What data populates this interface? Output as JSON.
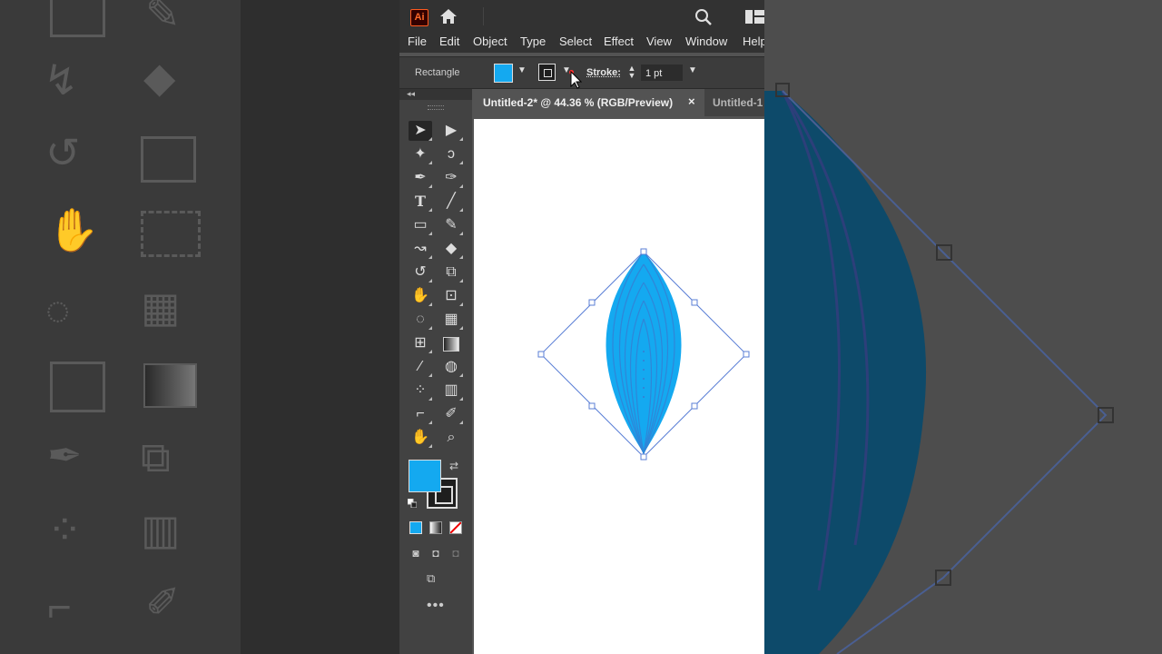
{
  "app": {
    "logo_text": "Ai"
  },
  "menu": [
    "File",
    "Edit",
    "Object",
    "Type",
    "Select",
    "Effect",
    "View",
    "Window",
    "Help"
  ],
  "control_bar": {
    "selection_label": "Rectangle",
    "fill_color": "#14a9f0",
    "stroke_label": "Stroke:",
    "stroke_weight": "1 pt"
  },
  "tabs": {
    "active": "Untitled-2* @ 44.36 % (RGB/Preview)",
    "close_symbol": "×",
    "inactive": "Untitled-1"
  },
  "toolbar": {
    "collapse": "◂◂",
    "tools": [
      "selection-tool",
      "direct-selection-tool",
      "magic-wand-tool",
      "lasso-tool",
      "pen-tool",
      "curvature-tool",
      "type-tool",
      "line-segment-tool",
      "rectangle-tool",
      "paintbrush-tool",
      "shaper-tool",
      "eraser-tool",
      "rotate-tool",
      "scale-tool",
      "puppet-warp-tool",
      "free-transform-tool",
      "shape-builder-tool",
      "perspective-grid-tool",
      "mesh-tool",
      "gradient-tool",
      "eyedropper-tool",
      "blend-tool",
      "symbol-sprayer-tool",
      "column-graph-tool",
      "artboard-tool",
      "slice-tool",
      "hand-tool",
      "zoom-tool"
    ],
    "fill_color": "#14a9f0",
    "more": "•••"
  },
  "artwork": {
    "shape_fill": "#14a9f0",
    "inner_stroke": "#2f86d8",
    "bounding_box_color": "#5b7fd6"
  }
}
